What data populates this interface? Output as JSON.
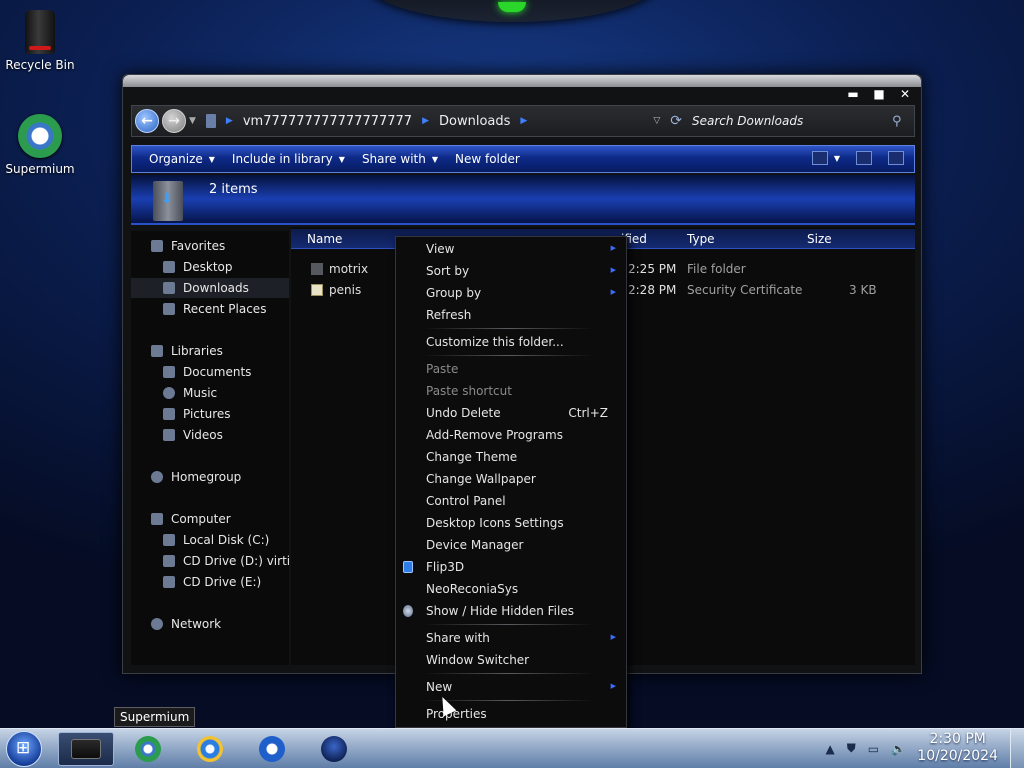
{
  "desktop": {
    "icons": [
      {
        "label": "Recycle Bin",
        "icon": "recycle-bin-icon"
      },
      {
        "label": "Supermium",
        "icon": "supermium-icon"
      }
    ]
  },
  "window": {
    "controls": {
      "minimize": "▬",
      "maximize": "■",
      "close": "✕"
    },
    "address": {
      "crumbs": [
        "vm777777777777777777",
        "Downloads"
      ],
      "search_placeholder": "Search Downloads"
    },
    "toolbar": {
      "organize": "Organize",
      "include_in_library": "Include in library",
      "share_with": "Share with",
      "new_folder": "New folder"
    },
    "details": {
      "items_count": "2 items"
    },
    "nav": {
      "favorites": "Favorites",
      "desktop": "Desktop",
      "downloads": "Downloads",
      "recent_places": "Recent Places",
      "libraries": "Libraries",
      "documents": "Documents",
      "music": "Music",
      "pictures": "Pictures",
      "videos": "Videos",
      "homegroup": "Homegroup",
      "computer": "Computer",
      "local_disk": "Local Disk (C:)",
      "cd_drive_d": "CD Drive (D:) virtio-w",
      "cd_drive_e": "CD Drive (E:)",
      "network": "Network"
    },
    "columns": {
      "name": "Name",
      "date_modified": "Date modified",
      "date_visible": "ified",
      "type": "Type",
      "size": "Size"
    },
    "files": [
      {
        "name": "motrix",
        "date": "2:25 PM",
        "type": "File folder",
        "size": ""
      },
      {
        "name": "penis",
        "date": "2:28 PM",
        "type": "Security Certificate",
        "size": "3 KB"
      }
    ]
  },
  "context_menu": {
    "view": "View",
    "sort_by": "Sort by",
    "group_by": "Group by",
    "refresh": "Refresh",
    "customize": "Customize this folder...",
    "paste": "Paste",
    "paste_shortcut": "Paste shortcut",
    "undo_delete": "Undo Delete",
    "undo_shortcut": "Ctrl+Z",
    "add_remove": "Add-Remove Programs",
    "change_theme": "Change Theme",
    "change_wallpaper": "Change Wallpaper",
    "control_panel": "Control Panel",
    "desktop_icons": "Desktop Icons Settings",
    "device_manager": "Device Manager",
    "flip3d": "Flip3D",
    "neoreconia": "NeoReconiaSys",
    "show_hide": "Show / Hide Hidden Files",
    "share_with": "Share with",
    "window_switcher": "Window Switcher",
    "new": "New",
    "properties": "Properties"
  },
  "tooltip": "Supermium",
  "taskbar": {
    "time": "2:30 PM",
    "date": "10/20/2024"
  },
  "colors": {
    "accent": "#2a52c8",
    "menu_arrow": "#3b6cff",
    "led": "#2ad62a"
  }
}
